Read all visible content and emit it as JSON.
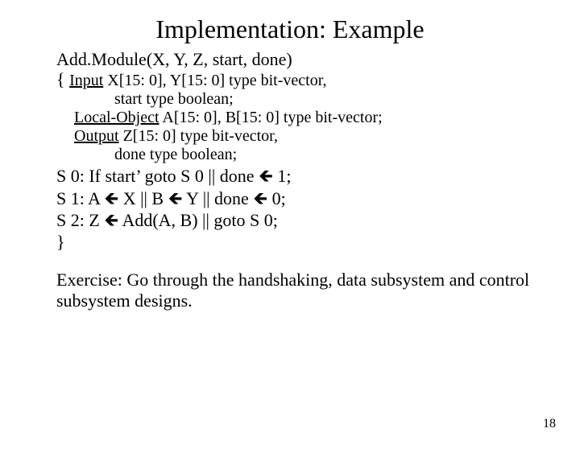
{
  "title": "Implementation: Example",
  "signature": "Add.Module(X, Y, Z, start, done)",
  "open_brace": "{",
  "decl": {
    "input_kw": "Input",
    "input_rest": " X[15: 0], Y[15: 0] type bit-vector,",
    "start_line": "start type boolean;",
    "local_kw": "Local-Object",
    "local_rest": " A[15: 0], B[15: 0] type bit-vector;",
    "output_kw": "Output",
    "output_rest": " Z[15: 0] type bit-vector,",
    "done_line": "done type boolean;"
  },
  "states": {
    "s0_a": "S 0: If start’ goto S 0 || done ",
    "s0_b": " 1;",
    "s1_a": "S 1: A ",
    "s1_b": " X || B ",
    "s1_c": " Y || done ",
    "s1_d": " 0;",
    "s2_a": "S 2: Z ",
    "s2_b": " Add(A, B) || goto S 0;",
    "close": "}"
  },
  "arrow": "🡸",
  "exercise": "Exercise: Go through the handshaking, data subsystem and control subsystem designs.",
  "page": "18"
}
